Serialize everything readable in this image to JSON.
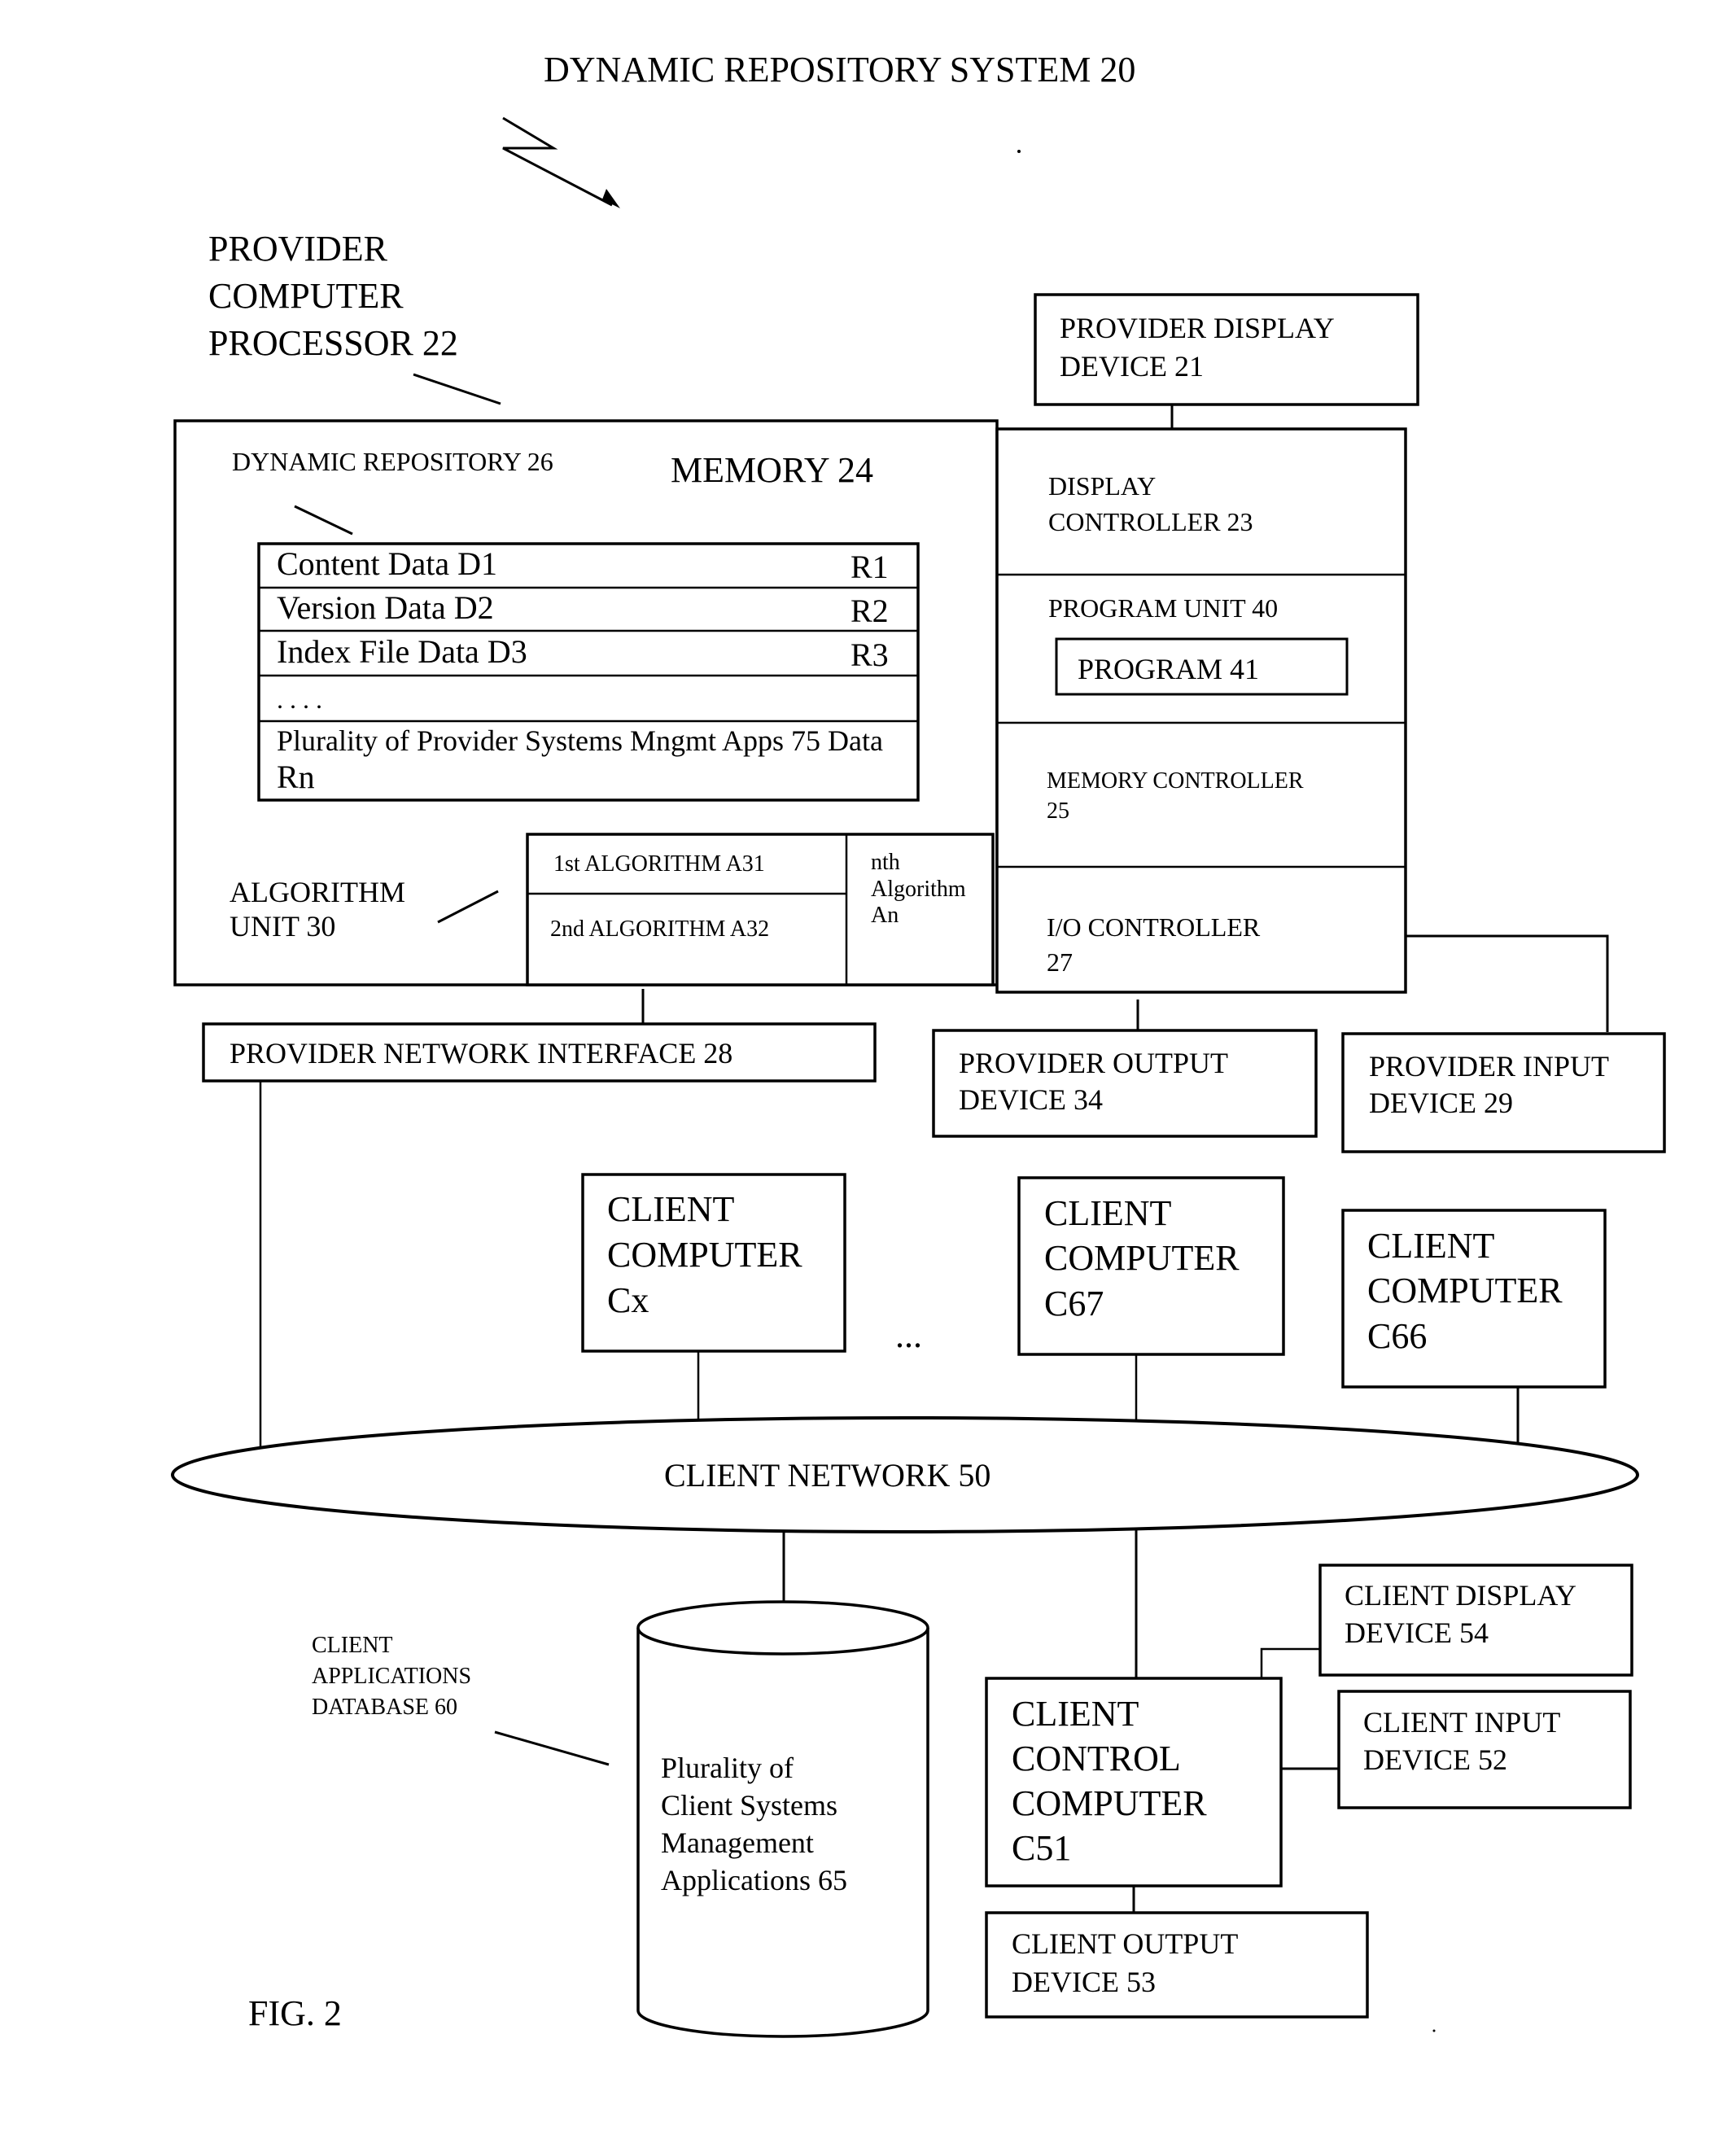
{
  "figure": {
    "title": "DYNAMIC REPOSITORY SYSTEM 20",
    "caption": "FIG. 2"
  },
  "provider": {
    "processor_label": [
      "PROVIDER",
      "COMPUTER",
      "PROCESSOR  22"
    ],
    "display_device": [
      "PROVIDER DISPLAY",
      "DEVICE  21"
    ],
    "memory": {
      "title": "MEMORY  24",
      "repository_label": "DYNAMIC REPOSITORY 26",
      "repository_rows": [
        {
          "label": "Content Data D1",
          "ref": "R1"
        },
        {
          "label": "Version Data D2",
          "ref": "R2"
        },
        {
          "label": "Index File Data D3",
          "ref": "R3"
        },
        {
          "label": ". . . .",
          "ref": ""
        },
        {
          "label": "Plurality of Provider Systems Mngmt Apps 75 Data",
          "ref": "Rn"
        }
      ],
      "algorithm_unit_label": [
        "ALGORITHM",
        "UNIT 30"
      ],
      "algorithms": [
        "1st ALGORITHM A31",
        "2nd ALGORITHM  A32"
      ],
      "nth_algorithm": [
        "nth",
        "Algorithm",
        "An"
      ]
    },
    "controllers": [
      {
        "lines": [
          "DISPLAY",
          "CONTROLLER  23"
        ]
      },
      {
        "lines": [
          "PROGRAM  UNIT  40"
        ],
        "inner": "PROGRAM 41"
      },
      {
        "lines": [
          "MEMORY CONTROLLER",
          "25"
        ]
      },
      {
        "lines": [
          "I/O CONTROLLER",
          "27"
        ]
      }
    ],
    "network_interface": "PROVIDER NETWORK INTERFACE 28",
    "output_device": [
      "PROVIDER OUTPUT",
      "DEVICE  34"
    ],
    "input_device": [
      "PROVIDER INPUT",
      "DEVICE 29"
    ]
  },
  "clients": {
    "computers": [
      {
        "lines": [
          "CLIENT",
          "COMPUTER",
          "Cx"
        ]
      },
      {
        "lines": [
          "CLIENT",
          "COMPUTER",
          "C67"
        ]
      },
      {
        "lines": [
          "CLIENT",
          "COMPUTER",
          "C66"
        ]
      }
    ],
    "ellipsis": "...",
    "network": "CLIENT NETWORK 50",
    "database_label": [
      "CLIENT",
      "APPLICATIONS",
      "DATABASE 60"
    ],
    "database_contents": [
      "Plurality  of",
      "Client Systems",
      "Management",
      "Applications  65"
    ],
    "control_computer": [
      "CLIENT",
      "CONTROL",
      "COMPUTER",
      "C51"
    ],
    "display_device": [
      "CLIENT DISPLAY",
      "DEVICE  54"
    ],
    "input_device": [
      "CLIENT INPUT",
      "DEVICE  52"
    ],
    "output_device": [
      "CLIENT OUTPUT",
      "DEVICE  53"
    ]
  }
}
